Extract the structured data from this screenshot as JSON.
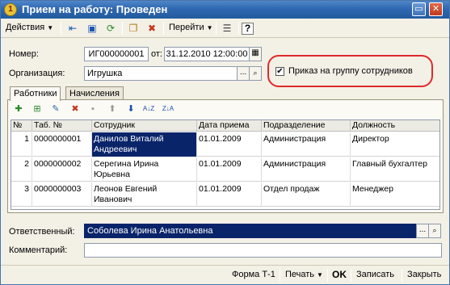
{
  "window": {
    "title": "Прием на работу: Проведен",
    "icon": "1c-document-icon",
    "restore_glyph": "▭",
    "close_glyph": "✕"
  },
  "toolbar": {
    "actions_label": "Действия",
    "go_label": "Перейти",
    "help_label": "?",
    "icons": [
      "post-document-icon",
      "print-preview-icon",
      "refresh-icon",
      "copy-document-icon",
      "clear-movements-icon",
      "structure-icon"
    ]
  },
  "header": {
    "number_label": "Номер:",
    "number_value": "ИГ000000001",
    "date_label": "от:",
    "date_value": "31.12.2010 12:00:00",
    "org_label": "Организация:",
    "org_value": "Игрушка",
    "select_glyph": "...",
    "open_glyph": "🔍",
    "group_order_label": "Приказ на группу сотрудников",
    "group_order_checked": "✔"
  },
  "tabs": [
    {
      "label": "Работники"
    },
    {
      "label": "Начисления"
    }
  ],
  "grid": {
    "columns": [
      "№",
      "Таб. №",
      "Сотрудник",
      "Дата приема",
      "Подразделение",
      "Должность"
    ],
    "rows": [
      {
        "n": "1",
        "tab": "0000000001",
        "employee": "Данилов Виталий Андреевич",
        "date": "01.01.2009",
        "dept": "Администрация",
        "position": "Директор"
      },
      {
        "n": "2",
        "tab": "0000000002",
        "employee": "Серегина Ирина Юрьевна",
        "date": "01.01.2009",
        "dept": "Администрация",
        "position": "Главный бухгалтер"
      },
      {
        "n": "3",
        "tab": "0000000003",
        "employee": "Леонов Евгений Иванович",
        "date": "01.01.2009",
        "dept": "Отдел продаж",
        "position": "Менеджер"
      }
    ]
  },
  "footer": {
    "responsible_label": "Ответственный:",
    "responsible_value": "Соболева Ирина Анатольевна",
    "comment_label": "Комментарий:",
    "comment_value": ""
  },
  "statusbar": {
    "form_label": "Форма Т-1",
    "print_label": "Печать",
    "ok_label": "OK",
    "save_label": "Записать",
    "close_label": "Закрыть"
  }
}
